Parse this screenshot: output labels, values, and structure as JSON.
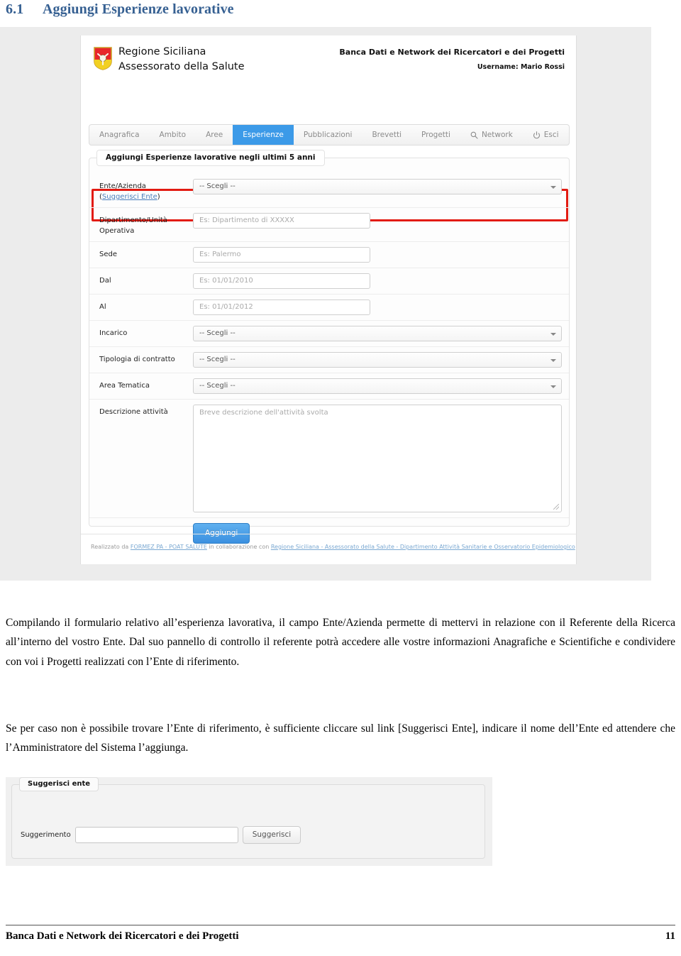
{
  "heading": {
    "number": "6.1",
    "text": "Aggiungi Esperienze lavorative"
  },
  "app": {
    "brand_line1": "Regione Siciliana",
    "brand_line2": "Assessorato della Salute",
    "title": "Banca Dati e Network dei Ricercatori e dei Progetti",
    "username": "Username: Mario Rossi",
    "nav": [
      {
        "label": "Anagrafica",
        "icon": "",
        "active": false
      },
      {
        "label": "Ambito",
        "icon": "",
        "active": false
      },
      {
        "label": "Aree",
        "icon": "",
        "active": false
      },
      {
        "label": "Esperienze",
        "icon": "",
        "active": true
      },
      {
        "label": "Pubblicazioni",
        "icon": "",
        "active": false
      },
      {
        "label": "Brevetti",
        "icon": "",
        "active": false
      },
      {
        "label": "Progetti",
        "icon": "",
        "active": false
      },
      {
        "label": "Network",
        "icon": "search-icon",
        "active": false
      },
      {
        "label": "Esci",
        "icon": "power-icon",
        "active": false
      }
    ],
    "form": {
      "legend": "Aggiungi Esperienze lavorative negli ultimi 5 anni",
      "ente_label": "Ente/Azienda",
      "ente_sublink_open": "(",
      "ente_sublink": "Suggerisci Ente",
      "ente_sublink_close": ")",
      "ente_value": "-- Scegli --",
      "dipartimento_label_line1": "Dipartimento/Unità",
      "dipartimento_label_line2": "Operativa",
      "dipartimento_placeholder": "Es: Dipartimento di XXXXX",
      "sede_label": "Sede",
      "sede_placeholder": "Es: Palermo",
      "dal_label": "Dal",
      "dal_placeholder": "Es: 01/01/2010",
      "al_label": "Al",
      "al_placeholder": "Es: 01/01/2012",
      "incarico_label": "Incarico",
      "incarico_value": "-- Scegli --",
      "tipologia_label": "Tipologia di contratto",
      "tipologia_value": "-- Scegli --",
      "area_label": "Area Tematica",
      "area_value": "-- Scegli --",
      "descrizione_label": "Descrizione attività",
      "descrizione_placeholder": "Breve descrizione dell'attività svolta",
      "submit_label": "Aggiungi"
    },
    "credits": {
      "prefix": "Realizzato da ",
      "link1": "FORMEZ PA - POAT SALUTE",
      "middle": " in collaborazione con ",
      "link2": "Regione Siciliana - Assessorato della Salute - Dipartimento Attività Sanitarie e Osservatorio Epidemiologico"
    }
  },
  "body": {
    "paragraph1": "Compilando il formulario relativo all’esperienza lavorativa, il campo Ente/Azienda permette di mettervi in relazione con il Referente della Ricerca all’interno del vostro Ente. Dal suo pannello di controllo il referente potrà accedere alle vostre informazioni Anagrafiche e Scientifiche e condividere con voi i Progetti realizzati con l’Ente di riferimento.",
    "paragraph2": "Se per caso non è possibile trovare l’Ente di riferimento, è sufficiente cliccare sul link [Suggerisci Ente], indicare il nome dell’Ente ed attendere che l’Amministratore del Sistema l’aggiunga."
  },
  "suggest_panel": {
    "legend": "Suggerisci ente",
    "label": "Suggerimento",
    "input_value": "",
    "button_label": "Suggerisci"
  },
  "footer": {
    "title": "Banca Dati e Network dei Ricercatori e dei Progetti",
    "page_number": "11"
  },
  "colors": {
    "heading": "#366092",
    "nav_active": "#3c9ae8",
    "highlight_box": "#e21b12",
    "primary_button": "#3b90e0",
    "link": "#4a7ebb"
  }
}
